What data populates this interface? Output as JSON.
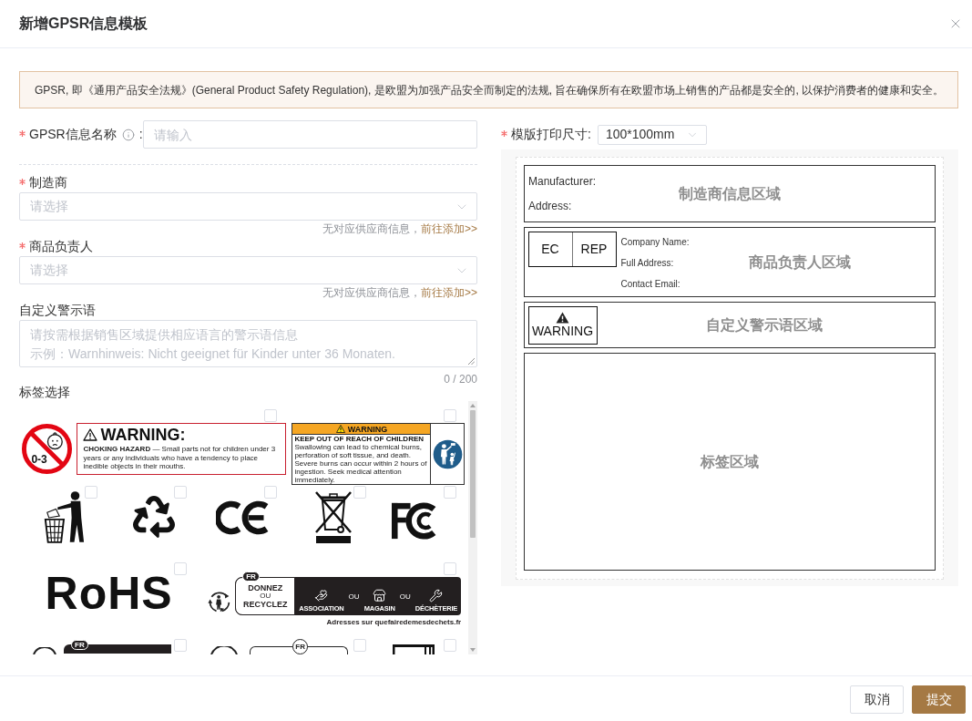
{
  "dialog": {
    "title": "新增GPSR信息模板"
  },
  "notice": {
    "text": "GPSR, 即《通用产品安全法规》(General Product Safety Regulation), 是欧盟为加强产品安全而制定的法规, 旨在确保所有在欧盟市场上销售的产品都是安全的, 以保护消费者的健康和安全。"
  },
  "form": {
    "fields": [
      {
        "kind": "input",
        "label": "GPSR信息名称",
        "required": true,
        "info": true,
        "suffix": ":",
        "placeholder": "请输入"
      },
      {
        "kind": "select",
        "label": "制造商",
        "required": true,
        "placeholder": "请选择",
        "hint": "无对应供应商信息，",
        "link": "前往添加>>"
      },
      {
        "kind": "select",
        "label": "商品负责人",
        "required": true,
        "placeholder": "请选择",
        "hint": "无对应供应商信息，",
        "link": "前往添加>>"
      },
      {
        "kind": "textarea",
        "label": "自定义警示语",
        "required": false,
        "placeholder": [
          "请按需根据销售区域提供相应语言的警示语信息",
          "示例：Warnhinweis: Nicht geeignet für Kinder unter 36 Monaten."
        ],
        "counter": "0 / 200"
      }
    ],
    "tags": {
      "label": "标签选择",
      "items": [
        {
          "kind": "choking",
          "checked": false,
          "age": "0-3",
          "heading": "WARNING:",
          "text": "**CHOKING HAZARD** — Small parts not for children under 3 years or any individuals who have a tendency to place inedible objects in their mouths."
        },
        {
          "kind": "keep-away",
          "checked": false,
          "heading": "WARNING",
          "subheading": "KEEP OUT OF REACH OF CHILDREN",
          "text": "Swallowing can lead to chemical burns, perforation of soft tissue, and death. Severe burns can occur within 2 hours of ingestion. Seek medical attention immediately."
        },
        {
          "kind": "litter",
          "checked": false
        },
        {
          "kind": "recycle",
          "checked": false
        },
        {
          "kind": "ce",
          "checked": false
        },
        {
          "kind": "weee",
          "checked": false
        },
        {
          "kind": "fcc",
          "checked": false
        },
        {
          "kind": "rohs",
          "checked": false,
          "wordmark": "RoHS"
        },
        {
          "kind": "sorting",
          "checked": false,
          "badge": "FR",
          "top": "DONNEZ",
          "joiner": "OU",
          "bottom": "RECYCLEZ",
          "destinations": [
            {
              "label": "ASSOCIATION"
            },
            {
              "joiner": "OU",
              "label": "MAGASIN"
            },
            {
              "joiner": "OU",
              "label": "DÉCHÈTERIE"
            }
          ],
          "footer": "Adresses sur quefairedemesdechets.fr"
        },
        {
          "kind": "sorting-strip",
          "checked": false,
          "badge": "FR"
        },
        {
          "kind": "sorting-outline",
          "checked": false,
          "badge": "FR"
        },
        {
          "kind": "box",
          "checked": false
        }
      ]
    }
  },
  "template": {
    "size_label": "模版打印尺寸:",
    "required": true,
    "size": "100*100mm",
    "zones": [
      {
        "kind": "manufacturer",
        "lines": [
          "Manufacturer:",
          "Address:"
        ],
        "watermark": "制造商信息区域"
      },
      {
        "kind": "responsible-person",
        "symbol": [
          "EC",
          "REP"
        ],
        "lines": [
          "Company Name:",
          "Full Address:",
          "Contact Email:"
        ],
        "watermark": "商品负责人区域"
      },
      {
        "kind": "warning",
        "symbol": "WARNING",
        "watermark": "自定义警示语区域"
      },
      {
        "kind": "labels",
        "watermark": "标签区域"
      }
    ]
  },
  "footer": {
    "buttons": [
      {
        "label": "取消",
        "kind": "secondary"
      },
      {
        "label": "提交",
        "kind": "primary"
      }
    ]
  }
}
